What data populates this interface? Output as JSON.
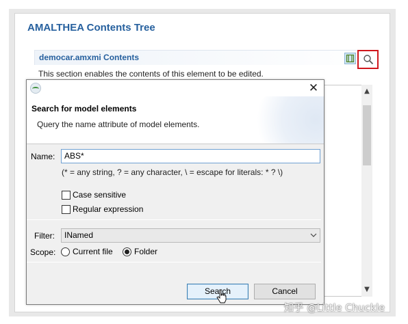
{
  "editor": {
    "title": "AMALTHEA Contents Tree",
    "section_title": "democar.amxmi Contents",
    "section_description": "This section enables the contents of this element to be edited.",
    "tree_button_icon": "tree-view-icon",
    "search_button_icon": "search-icon"
  },
  "dialog": {
    "app_icon": "amalthea-icon",
    "close_glyph": "✕",
    "header_title": "Search for model elements",
    "header_message": "Query the name attribute of model elements.",
    "name_label": "Name:",
    "name_value": "ABS*",
    "hint": "(* = any string, ? = any character, \\ = escape for literals: * ? \\)",
    "case_sensitive_label": "Case sensitive",
    "case_sensitive_checked": false,
    "regex_label": "Regular expression",
    "regex_checked": false,
    "filter_label": "Filter:",
    "filter_value": "INamed",
    "scope_label": "Scope:",
    "scope_options": [
      "Current file",
      "Folder"
    ],
    "scope_selected": "Folder",
    "search_button": "Search",
    "cancel_button": "Cancel"
  },
  "watermark": "知乎 @Little Chuckle",
  "colors": {
    "accent_blue": "#26609e",
    "highlight_red": "#d0161c"
  }
}
